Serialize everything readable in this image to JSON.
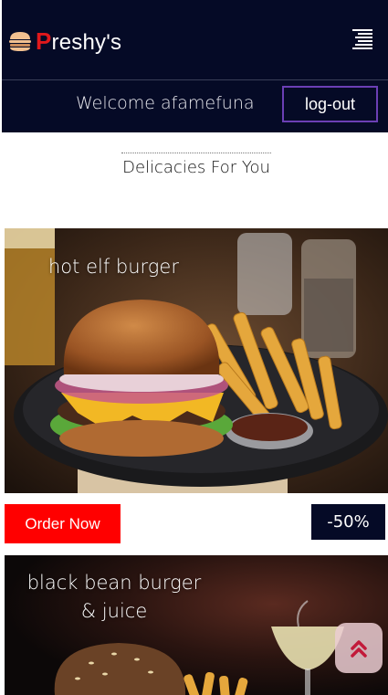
{
  "header": {
    "brand_initial": "P",
    "brand_rest": "reshy's",
    "brand_icon": "burger-icon",
    "menu_icon": "menu-lines-icon"
  },
  "welcome": {
    "text": "Welcome afamefuna",
    "logout_label": "log-out"
  },
  "section": {
    "title": "Delicacies For You"
  },
  "items": [
    {
      "title": "hot elf burger",
      "order_label": "Order Now",
      "discount": "-50%"
    },
    {
      "title_line1": "black bean burger",
      "title_line2": "& juice"
    }
  ],
  "scroll_top_icon": "double-chevron-up-icon",
  "colors": {
    "navbar": "#050a26",
    "brand_accent": "#e0181b",
    "order_button": "#ff0000",
    "logout_border": "#6b3fb5"
  }
}
